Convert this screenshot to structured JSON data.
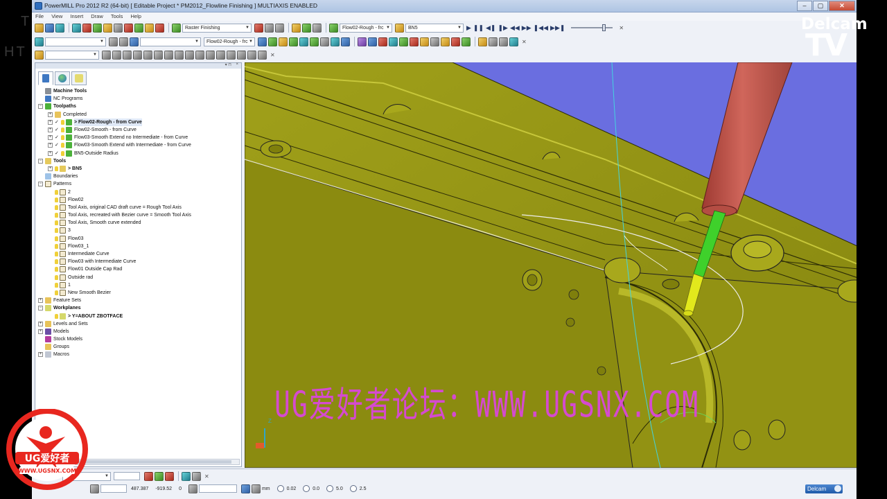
{
  "window": {
    "title": "PowerMILL Pro 2012 R2 (64-bit)     [ Editable Project * PM2012_Flowline Finishing ]     MULTIAXIS ENABLED",
    "controls": {
      "minimize": "–",
      "maximize": "▢",
      "close": "✕"
    }
  },
  "menu": [
    "File",
    "View",
    "Insert",
    "Draw",
    "Tools",
    "Help"
  ],
  "toolbar1": {
    "strategy_label": "Raster Finishing",
    "toolpath_select": "Flow02-Rough - frc",
    "tool_select": "BN5"
  },
  "toolbar2": {
    "toolpath_select": "Flow02-Rough - frc"
  },
  "explorer": {
    "pin": "▾ ⊓",
    "close": "×",
    "tree": [
      {
        "level": 0,
        "expander": "",
        "icon": "cad",
        "label": "Machine Tools",
        "bold": true
      },
      {
        "level": 0,
        "expander": "",
        "icon": "blu",
        "label": "NC Programs",
        "bold": false
      },
      {
        "level": 0,
        "expander": "−",
        "icon": "grn",
        "label": "Toolpaths",
        "bold": true
      },
      {
        "level": 1,
        "expander": "+",
        "icon": "fold",
        "label": "Completed",
        "bold": false
      },
      {
        "level": 1,
        "expander": "+",
        "check": "✓",
        "bulb": true,
        "icon": "grn",
        "label": "> Flow02-Rough - from Curve",
        "bold": true,
        "highlight": true
      },
      {
        "level": 1,
        "expander": "+",
        "check": "✓",
        "bulb": true,
        "icon": "grn",
        "label": "Flow02-Smooth - from Curve",
        "bold": false
      },
      {
        "level": 1,
        "expander": "+",
        "check": "✓",
        "bulb": true,
        "icon": "grn",
        "label": "Flow03-Smooth Extend no Intermediate - from Curve",
        "bold": false
      },
      {
        "level": 1,
        "expander": "+",
        "check": "✓",
        "bulb": true,
        "icon": "grn",
        "label": "Flow03-Smooth Extend with Intermediate - from Curve",
        "bold": false
      },
      {
        "level": 1,
        "expander": "+",
        "check": "✓",
        "bulb": true,
        "icon": "grn",
        "label": "BN5-Outside Radius",
        "bold": false
      },
      {
        "level": 0,
        "expander": "−",
        "icon": "tool",
        "label": "Tools",
        "bold": true
      },
      {
        "level": 1,
        "expander": "+",
        "bulb": true,
        "icon": "tool",
        "label": "> BN5",
        "bold": true
      },
      {
        "level": 0,
        "expander": "",
        "icon": "bnd",
        "label": "Boundaries",
        "bold": false
      },
      {
        "level": 0,
        "expander": "−",
        "icon": "pat",
        "label": "Patterns",
        "bold": false
      },
      {
        "level": 1,
        "expander": "",
        "bulb": true,
        "icon": "pat",
        "label": "2",
        "bold": false
      },
      {
        "level": 1,
        "expander": "",
        "bulb": true,
        "icon": "pat",
        "label": "Flow02",
        "bold": false
      },
      {
        "level": 1,
        "expander": "",
        "bulb": true,
        "icon": "pat",
        "label": "Tool Axis, original CAD draft curve = Rough Tool Axis",
        "bold": false
      },
      {
        "level": 1,
        "expander": "",
        "bulb": true,
        "icon": "pat",
        "label": "Tool Axis, recreated with Bezier curve = Smooth Tool Axis",
        "bold": false
      },
      {
        "level": 1,
        "expander": "",
        "bulb": true,
        "icon": "pat",
        "label": "Tool Axis, Smooth curve extended",
        "bold": false
      },
      {
        "level": 1,
        "expander": "",
        "bulb": true,
        "icon": "pat",
        "label": "3",
        "bold": false
      },
      {
        "level": 1,
        "expander": "",
        "bulb": true,
        "icon": "pat",
        "label": "Flow03",
        "bold": false
      },
      {
        "level": 1,
        "expander": "",
        "bulb": true,
        "icon": "pat",
        "label": "Flow03_1",
        "bold": false
      },
      {
        "level": 1,
        "expander": "",
        "bulb": true,
        "icon": "pat",
        "label": "Intermediate Curve",
        "bold": false
      },
      {
        "level": 1,
        "expander": "",
        "bulb": true,
        "icon": "pat",
        "label": "Flow03 with Intermediate Curve",
        "bold": false
      },
      {
        "level": 1,
        "expander": "",
        "bulb": true,
        "icon": "pat",
        "label": "Flow01 Outside Cap Rad",
        "bold": false
      },
      {
        "level": 1,
        "expander": "",
        "bulb": true,
        "icon": "pat",
        "label": "Outside rad",
        "bold": false
      },
      {
        "level": 1,
        "expander": "",
        "bulb": true,
        "icon": "pat",
        "label": "1",
        "bold": false
      },
      {
        "level": 1,
        "expander": "",
        "bulb": true,
        "icon": "pat",
        "label": "New Smooth Bezier",
        "bold": false
      },
      {
        "level": 0,
        "expander": "+",
        "icon": "fold",
        "label": "Feature Sets",
        "bold": false
      },
      {
        "level": 0,
        "expander": "−",
        "icon": "wp",
        "label": "Workplanes",
        "bold": true
      },
      {
        "level": 1,
        "expander": "",
        "bulb": true,
        "icon": "wp",
        "label": "> Y=ABOUT ZBOTFACE",
        "bold": true
      },
      {
        "level": 0,
        "expander": "+",
        "icon": "fold",
        "label": "Levels and Sets",
        "bold": false
      },
      {
        "level": 0,
        "expander": "+",
        "icon": "mod",
        "label": "Models",
        "bold": false
      },
      {
        "level": 0,
        "expander": "",
        "icon": "stk",
        "label": "Stock Models",
        "bold": false
      },
      {
        "level": 0,
        "expander": "",
        "icon": "fold",
        "label": "Groups",
        "bold": false
      },
      {
        "level": 0,
        "expander": "+",
        "icon": "mac",
        "label": "Macros",
        "bold": false
      }
    ]
  },
  "viewport": {
    "watermark": "UG爱好者论坛：WWW.UGSNX.COM",
    "axis_label": "Z"
  },
  "status": {
    "x": "487.387",
    "y": "-919.52",
    "z": "0",
    "units": "mm",
    "tolerance": "0.02",
    "thickness": "0.0",
    "diameter": "5.0",
    "angle": "2.5",
    "brand": "Delcam"
  },
  "overlay": {
    "tv_top": "Delcam",
    "tv_bottom": "TV",
    "ug_logo_text": "UG爱好者",
    "ug_logo_url": "WWW.UGSNX.COM"
  },
  "colors": {
    "part": "#8f8f14",
    "part_light": "#b1b11e",
    "background": "#6a6ee0",
    "holder": "#c4584e",
    "tool_green": "#3fd12b",
    "tool_yellow": "#e2e81c",
    "watermark": "#d54ad0"
  }
}
